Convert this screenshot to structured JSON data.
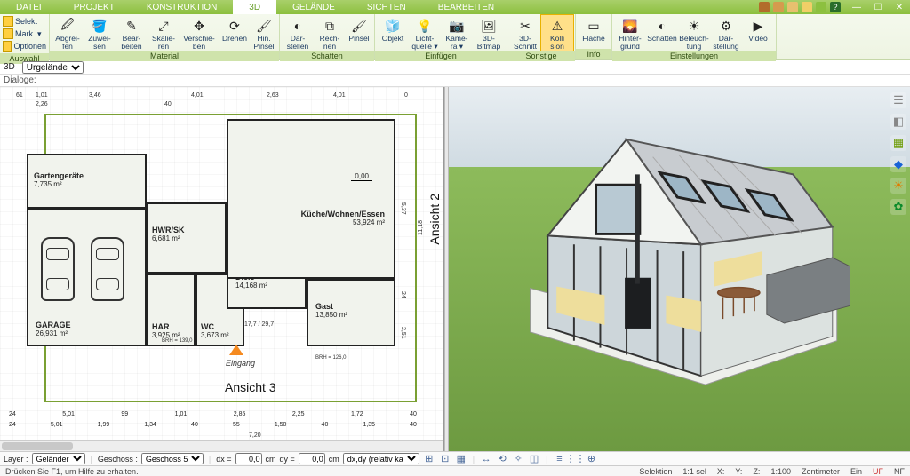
{
  "menu": {
    "tabs": [
      "DATEI",
      "PROJEKT",
      "KONSTRUKTION",
      "3D",
      "GELÄNDE",
      "SICHTEN",
      "BEARBEITEN"
    ],
    "active_index": 3,
    "help_glyph": "?"
  },
  "ribbon": {
    "auswahl": {
      "select": "Selekt",
      "mark": "Mark. ▾",
      "optionen": "Optionen",
      "label": "Auswahl"
    },
    "groups": [
      {
        "label": "Material",
        "buttons": [
          {
            "id": "abgreifen",
            "label": "Abgrei-\nfen"
          },
          {
            "id": "zuweisen",
            "label": "Zuwei-\nsen"
          },
          {
            "id": "bearbeiten",
            "label": "Bear-\nbeiten"
          },
          {
            "id": "skalieren",
            "label": "Skalie-\nren"
          },
          {
            "id": "verschieben",
            "label": "Verschie-\nben"
          },
          {
            "id": "drehen",
            "label": "Drehen"
          },
          {
            "id": "hinpinsel",
            "label": "Hin.\nPinsel"
          }
        ]
      },
      {
        "label": "Schatten",
        "buttons": [
          {
            "id": "darstellen",
            "label": "Dar-\nstellen"
          },
          {
            "id": "rechnen",
            "label": "Rech-\nnen"
          },
          {
            "id": "pinsel",
            "label": "Pinsel"
          }
        ]
      },
      {
        "label": "Einfügen",
        "buttons": [
          {
            "id": "objekt",
            "label": "Objekt"
          },
          {
            "id": "lichtquelle",
            "label": "Licht-\nquelle ▾"
          },
          {
            "id": "kamera",
            "label": "Kame-\nra ▾"
          },
          {
            "id": "bitmap3d",
            "label": "3D-\nBitmap"
          }
        ]
      },
      {
        "label": "Sonstige",
        "buttons": [
          {
            "id": "schnitt3d",
            "label": "3D-\nSchnitt"
          },
          {
            "id": "kollision",
            "label": "Kolli\nsion",
            "selected": true
          }
        ]
      },
      {
        "label": "Info",
        "buttons": [
          {
            "id": "flaeche",
            "label": "Fläche"
          }
        ]
      },
      {
        "label": "Einstellungen",
        "buttons": [
          {
            "id": "hintergrund",
            "label": "Hinter-\ngrund"
          },
          {
            "id": "schatten2",
            "label": "Schatten"
          },
          {
            "id": "beleuchtung",
            "label": "Beleuch-\ntung"
          },
          {
            "id": "darstellung",
            "label": "Dar-\nstellung"
          },
          {
            "id": "video",
            "label": "Video"
          }
        ]
      }
    ]
  },
  "subbar": {
    "mode": "3D",
    "terrain": "Urgelände"
  },
  "dialoge_label": "Dialoge:",
  "plan": {
    "rooms": [
      {
        "name": "Gartengeräte",
        "area": "7,735 m²"
      },
      {
        "name": "GARAGE",
        "area": "26,931 m²"
      },
      {
        "name": "HAR",
        "area": "3,925 m²"
      },
      {
        "name": "HWR/SK",
        "area": "6,681 m²"
      },
      {
        "name": "WC",
        "area": "3,673 m²"
      },
      {
        "name": "Diele",
        "area": "14,168 m²"
      },
      {
        "name": "Küche/Wohnen/Essen",
        "area": "53,924 m²"
      },
      {
        "name": "Gast",
        "area": "13,850 m²"
      }
    ],
    "eingang": "Eingang",
    "ansicht2": "Ansicht 2",
    "ansicht3": "Ansicht 3",
    "level": "0,00",
    "brh": "BRH = 126,0",
    "brh2": "BRH = 139,0",
    "flur": "17,7 / 29,7",
    "dims_top_outer": [
      "61",
      "1,01",
      "3,46",
      "4,01",
      "2,63",
      "4,01",
      "0"
    ],
    "dims_top_inner": [
      "2,26",
      "40"
    ],
    "dim_left_11": "11,18",
    "dims_bottom1": [
      "24",
      "5,01",
      "99",
      "1,01",
      "2,85",
      "2,25",
      "1,72",
      "40"
    ],
    "dims_bottom2": [
      "24",
      "5,01",
      "1,99",
      "1,34",
      "40",
      "55",
      "1,50",
      "40",
      "1,35",
      "40"
    ],
    "dims_bottom3": "7,20",
    "dims_right": [
      "2,51",
      "24",
      "5,37"
    ]
  },
  "side_icons": [
    "☰",
    "◧",
    "▦",
    "◆",
    "☀",
    "✿"
  ],
  "bottom": {
    "layer_label": "Layer :",
    "layer": "Geländer",
    "geschoss_label": "Geschoss :",
    "geschoss": "Geschoss 5",
    "dx_label": "dx =",
    "dx": "0,0",
    "dy_label": "dy =",
    "dy": "0,0",
    "unit": "cm",
    "mode": "dx,dy (relativ ka"
  },
  "status": {
    "hint": "Drücken Sie F1, um Hilfe zu erhalten.",
    "selektion": "Selektion",
    "scale_sel": "1:1 sel",
    "X": "X:",
    "Y": "Y:",
    "Z": "Z:",
    "scale": "1:100",
    "unit": "Zentimeter",
    "ein": "Ein",
    "uf": "UF",
    "nf": "NF"
  }
}
